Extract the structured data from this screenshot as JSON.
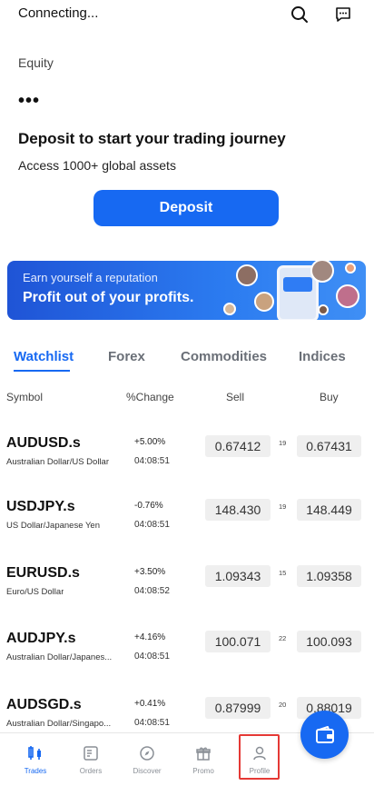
{
  "header": {
    "status": "Connecting...",
    "search_icon": "search-icon",
    "chat_icon": "chat-icon"
  },
  "account": {
    "equity_label": "Equity",
    "equity_value": "•••",
    "deposit_title": "Deposit to start your trading journey",
    "deposit_subtitle": "Access 1000+ global assets",
    "deposit_button": "Deposit"
  },
  "banner": {
    "line1": "Earn yourself a reputation",
    "line2": "Profit out of your profits."
  },
  "tabs": [
    {
      "label": "Watchlist",
      "active": true
    },
    {
      "label": "Forex",
      "active": false
    },
    {
      "label": "Commodities",
      "active": false
    },
    {
      "label": "Indices",
      "active": false
    }
  ],
  "table": {
    "headers": {
      "symbol": "Symbol",
      "change": "%Change",
      "sell": "Sell",
      "buy": "Buy"
    },
    "rows": [
      {
        "symbol": "AUDUSD.s",
        "desc": "Australian Dollar/US Dollar",
        "change": "+5.00%",
        "time": "04:08:51",
        "sell": "0.67412",
        "spread": "19",
        "buy": "0.67431"
      },
      {
        "symbol": "USDJPY.s",
        "desc": "US Dollar/Japanese Yen",
        "change": "-0.76%",
        "time": "04:08:51",
        "sell": "148.430",
        "spread": "19",
        "buy": "148.449"
      },
      {
        "symbol": "EURUSD.s",
        "desc": "Euro/US Dollar",
        "change": "+3.50%",
        "time": "04:08:52",
        "sell": "1.09343",
        "spread": "15",
        "buy": "1.09358"
      },
      {
        "symbol": "AUDJPY.s",
        "desc": "Australian Dollar/Japanes...",
        "change": "+4.16%",
        "time": "04:08:51",
        "sell": "100.071",
        "spread": "22",
        "buy": "100.093"
      },
      {
        "symbol": "AUDSGD.s",
        "desc": "Australian Dollar/Singapo...",
        "change": "+0.41%",
        "time": "04:08:51",
        "sell": "0.87999",
        "spread": "20",
        "buy": "0.88019"
      }
    ]
  },
  "bottom_nav": [
    {
      "label": "Trades",
      "icon": "trades-icon",
      "active": true
    },
    {
      "label": "Orders",
      "icon": "orders-icon",
      "active": false
    },
    {
      "label": "Discover",
      "icon": "discover-icon",
      "active": false
    },
    {
      "label": "Promo",
      "icon": "promo-icon",
      "active": false
    },
    {
      "label": "Profile",
      "icon": "profile-icon",
      "active": false
    }
  ],
  "colors": {
    "accent": "#1769f2",
    "highlight": "#e53935"
  }
}
